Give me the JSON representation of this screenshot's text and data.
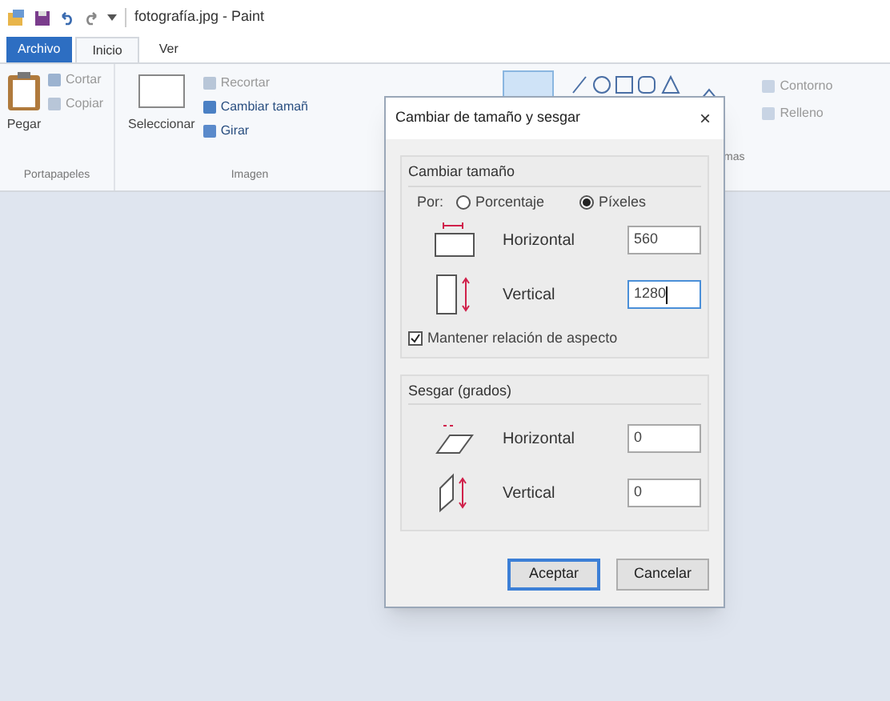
{
  "window": {
    "title": "fotografía.jpg - Paint"
  },
  "tabs": [
    {
      "label": "Archivo",
      "kind": "file",
      "selected": false
    },
    {
      "label": "Inicio",
      "kind": "tab",
      "selected": true
    },
    {
      "label": "Ver",
      "kind": "tab",
      "selected": false
    }
  ],
  "ribbon": {
    "clipboard": {
      "paste": "Pegar",
      "cut": "Cortar",
      "copy": "Copiar",
      "label": "Portapapeles"
    },
    "image": {
      "select": "Seleccionar",
      "crop": "Recortar",
      "resize": "Cambiar tamañ",
      "rotate": "Girar",
      "label": "Imagen"
    },
    "shapes": {
      "outline": "Contorno",
      "fill": "Relleno",
      "label": "mas"
    }
  },
  "dialog": {
    "title": "Cambiar de tamaño y sesgar",
    "close": "×",
    "resize": {
      "title": "Cambiar tamaño",
      "by": "Por:",
      "options": [
        {
          "label": "Porcentaje",
          "selected": false
        },
        {
          "label": "Píxeles",
          "selected": true
        }
      ],
      "fields": [
        {
          "label": "Horizontal",
          "value": "560"
        },
        {
          "label": "Vertical",
          "value": "1280",
          "focused": true
        }
      ],
      "keep_ratio": {
        "label": "Mantener relación de aspecto",
        "checked": true
      }
    },
    "skew": {
      "title": "Sesgar (grados)",
      "fields": [
        {
          "label": "Horizontal",
          "value": "0"
        },
        {
          "label": "Vertical",
          "value": "0"
        }
      ]
    },
    "buttons": [
      {
        "label": "Aceptar",
        "default": true
      },
      {
        "label": "Cancelar",
        "default": false
      }
    ]
  }
}
